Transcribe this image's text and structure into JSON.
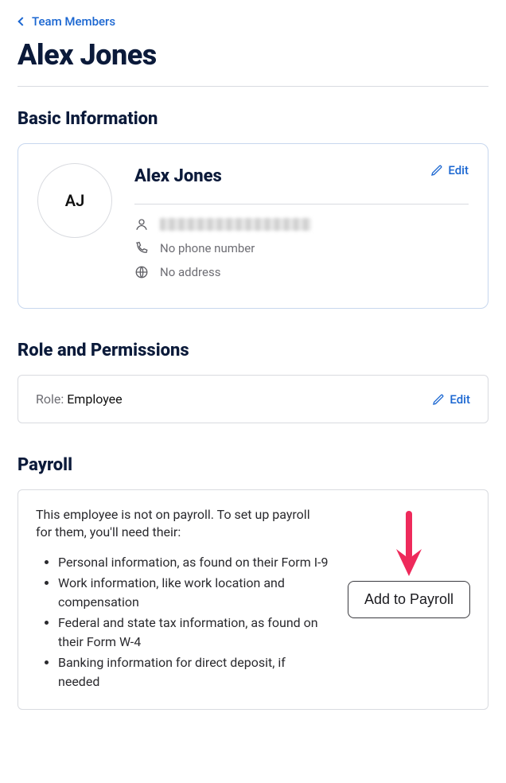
{
  "breadcrumb": {
    "label": "Team Members"
  },
  "page_title": "Alex Jones",
  "sections": {
    "basic": {
      "title": "Basic Information",
      "name": "Alex Jones",
      "initials": "AJ",
      "edit_label": "Edit",
      "phone_text": "No phone number",
      "address_text": "No address"
    },
    "role": {
      "title": "Role and Permissions",
      "label": "Role:",
      "value": "Employee",
      "edit_label": "Edit"
    },
    "payroll": {
      "title": "Payroll",
      "intro": "This employee is not on payroll. To set up payroll for them, you'll need their:",
      "items": [
        "Personal information, as found on their Form I-9",
        "Work information, like work location and compensation",
        "Federal and state tax information, as found on their Form W-4",
        "Banking information for direct deposit, if needed"
      ],
      "button_label": "Add to Payroll"
    }
  }
}
